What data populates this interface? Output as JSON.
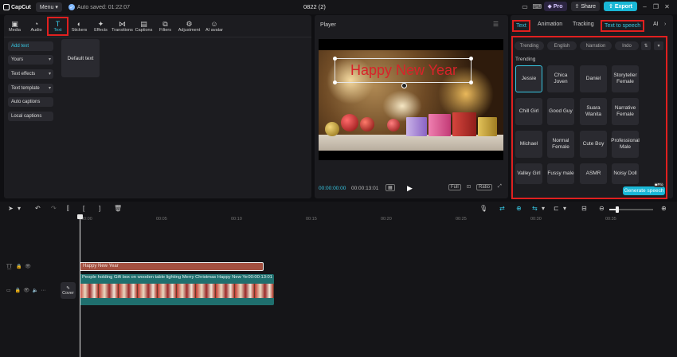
{
  "app": {
    "name": "CapCut",
    "menu_label": "Menu",
    "autosave_text": "Auto saved: 01:22:07",
    "project_title": "0822 (2)",
    "pro_label": "Pro",
    "share_label": "Share",
    "export_label": "Export"
  },
  "toolbar": {
    "items": [
      {
        "label": "Media",
        "icon": "media-icon"
      },
      {
        "label": "Audio",
        "icon": "audio-icon"
      },
      {
        "label": "Text",
        "icon": "text-icon"
      },
      {
        "label": "Stickers",
        "icon": "stickers-icon"
      },
      {
        "label": "Effects",
        "icon": "effects-icon"
      },
      {
        "label": "Transitions",
        "icon": "transitions-icon"
      },
      {
        "label": "Captions",
        "icon": "captions-icon"
      },
      {
        "label": "Filters",
        "icon": "filters-icon"
      },
      {
        "label": "Adjustment",
        "icon": "adjustment-icon"
      },
      {
        "label": "AI avatar",
        "icon": "ai-avatar-icon"
      }
    ],
    "active": "Text"
  },
  "text_menu": {
    "items": [
      "Add text",
      "Yours",
      "Text effects",
      "Text template",
      "Auto captions",
      "Local captions"
    ],
    "default_card": "Default text"
  },
  "player": {
    "title": "Player",
    "overlay_text": "Happy New Year",
    "current_time": "00:00:00:00",
    "total_time": "00:00:13:01",
    "ratio_label": "Ratio",
    "full_label": "Full"
  },
  "right_panel": {
    "tabs": [
      "Text",
      "Animation",
      "Tracking",
      "Text to speech",
      "AI"
    ],
    "filters": [
      "Trending",
      "English",
      "Narration",
      "Indo"
    ],
    "section_label": "Trending",
    "voices": [
      [
        "Jessie",
        "Chica Joven",
        "Daniel",
        "Storyteller Female"
      ],
      [
        "Chill Girl",
        "Good Guy",
        "Suara Wanita",
        "Narrative Female"
      ],
      [
        "Michael",
        "Normal Female",
        "Cute Boy",
        "Professional Male"
      ],
      [
        "Valley Girl",
        "Fussy male",
        "ASMR",
        "Noisy Doll"
      ]
    ],
    "selected_voice": "Jessie",
    "generate_label": "Generate speech",
    "pro_badge": "Pro"
  },
  "timeline": {
    "ticks": [
      "00:00",
      "00:05",
      "00:10",
      "00:15",
      "00:20",
      "00:25",
      "00:30",
      "00:35"
    ],
    "text_clip": "Happy New Year",
    "video_clip": "People holding Gift box on wooden table lighting Merry Christmas Happy New Ye",
    "video_duration": "00:00:13:01",
    "cover_label": "Cover"
  },
  "colors": {
    "accent": "#19b7d6",
    "highlight": "#e0201f",
    "text_clip": "#a35040",
    "video_clip": "#1f6f6e"
  }
}
